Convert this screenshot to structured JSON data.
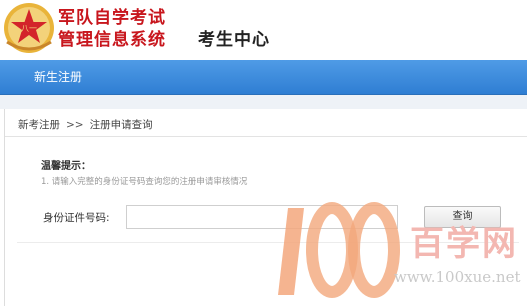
{
  "header": {
    "title_line1": "军队自学考试",
    "title_line2": "管理信息系统",
    "subtitle": "考生中心",
    "emblem_text": "八一"
  },
  "nav": {
    "active_tab": "新生注册"
  },
  "breadcrumb": {
    "item1": "新考注册",
    "separator": ">>",
    "item2": "注册申请查询"
  },
  "tips": {
    "title": "温馨提示：",
    "line1": "1. 请输入完整的身份证号码查询您的注册申请审核情况"
  },
  "form": {
    "id_label": "身份证件号码:",
    "id_value": "",
    "id_placeholder": "",
    "query_button": "查询"
  },
  "watermark": {
    "brand_cn": "百学网",
    "url": "www.100xue.net"
  },
  "colors": {
    "title_red": "#c8161d",
    "nav_blue": "#2f7ed3",
    "watermark_orange": "#f0a47a"
  }
}
